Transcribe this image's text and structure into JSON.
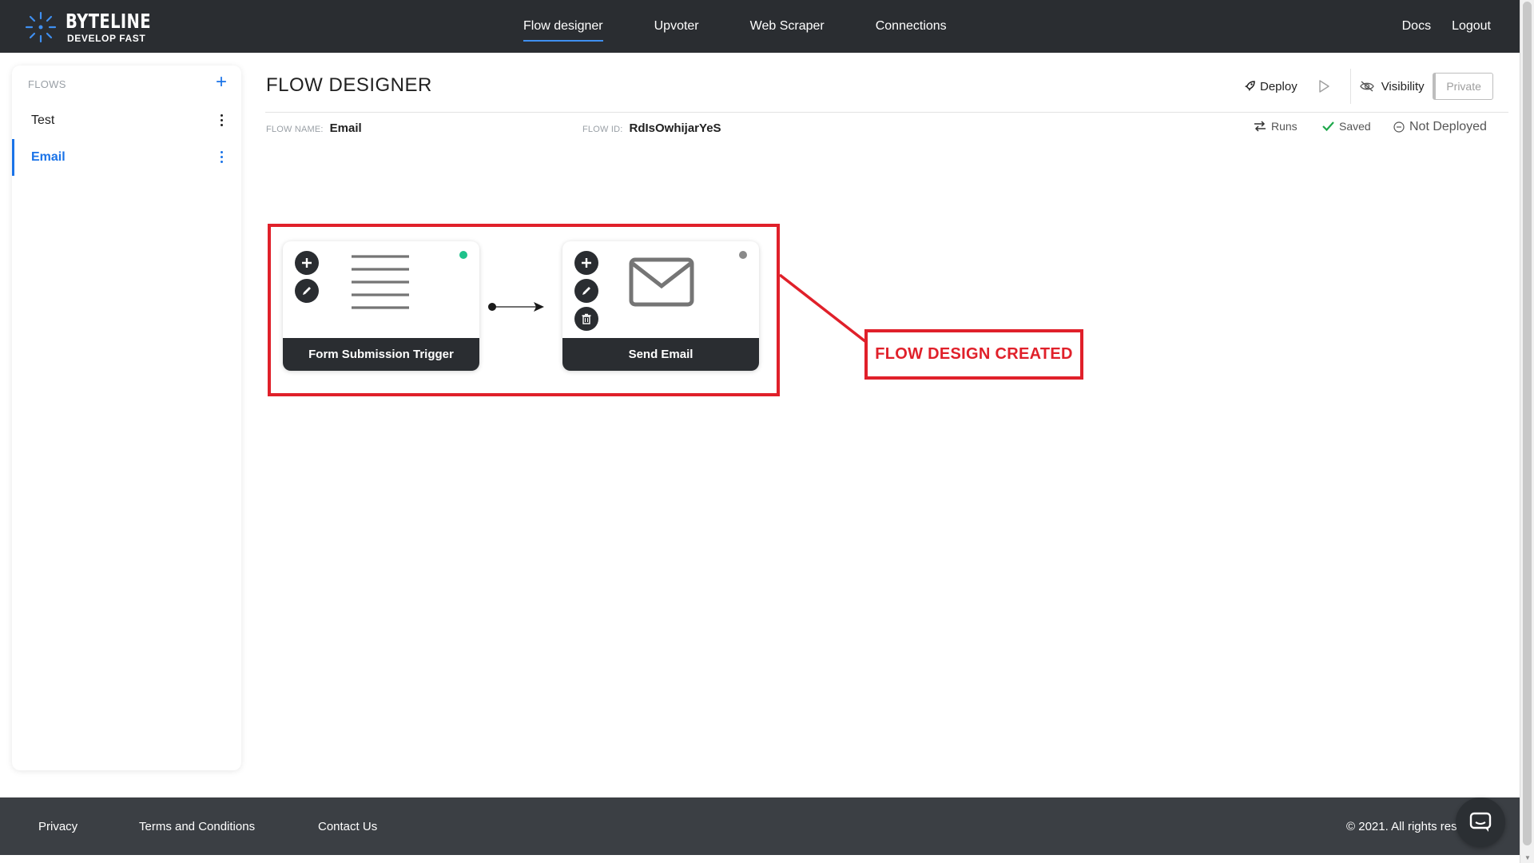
{
  "brand": {
    "name": "BYTELINE",
    "tagline": "DEVELOP FAST"
  },
  "nav": {
    "items": [
      {
        "label": "Flow designer",
        "active": true
      },
      {
        "label": "Upvoter"
      },
      {
        "label": "Web Scraper"
      },
      {
        "label": "Connections"
      }
    ],
    "right": {
      "docs": "Docs",
      "logout": "Logout"
    }
  },
  "sidebar": {
    "heading": "FLOWS",
    "add_icon": "plus-icon",
    "items": [
      {
        "label": "Test",
        "active": false
      },
      {
        "label": "Email",
        "active": true
      }
    ]
  },
  "header": {
    "title": "FLOW DESIGNER",
    "deploy": "Deploy",
    "visibility": "Visibility",
    "private": "Private"
  },
  "meta": {
    "flow_name_label": "FLOW NAME:",
    "flow_name": "Email",
    "flow_id_label": "FLOW ID:",
    "flow_id": "RdIsOwhijarYeS"
  },
  "status": {
    "runs": "Runs",
    "saved": "Saved",
    "deployed": "Not Deployed"
  },
  "flow": {
    "nodes": [
      {
        "label": "Form Submission Trigger",
        "icon": "list-lines-icon",
        "status_color": "#1ec28b"
      },
      {
        "label": "Send Email",
        "icon": "envelope-icon",
        "status_color": "#8a8a8a"
      }
    ]
  },
  "annotation": {
    "text": "FLOW DESIGN CREATED",
    "color": "#e0202a"
  },
  "footer": {
    "privacy": "Privacy",
    "terms": "Terms and Conditions",
    "contact": "Contact Us",
    "copyright": "© 2021. All rights rese"
  },
  "colors": {
    "topbar": "#2a2d31",
    "accent": "#1a73e8",
    "footer": "#3b3f44"
  }
}
